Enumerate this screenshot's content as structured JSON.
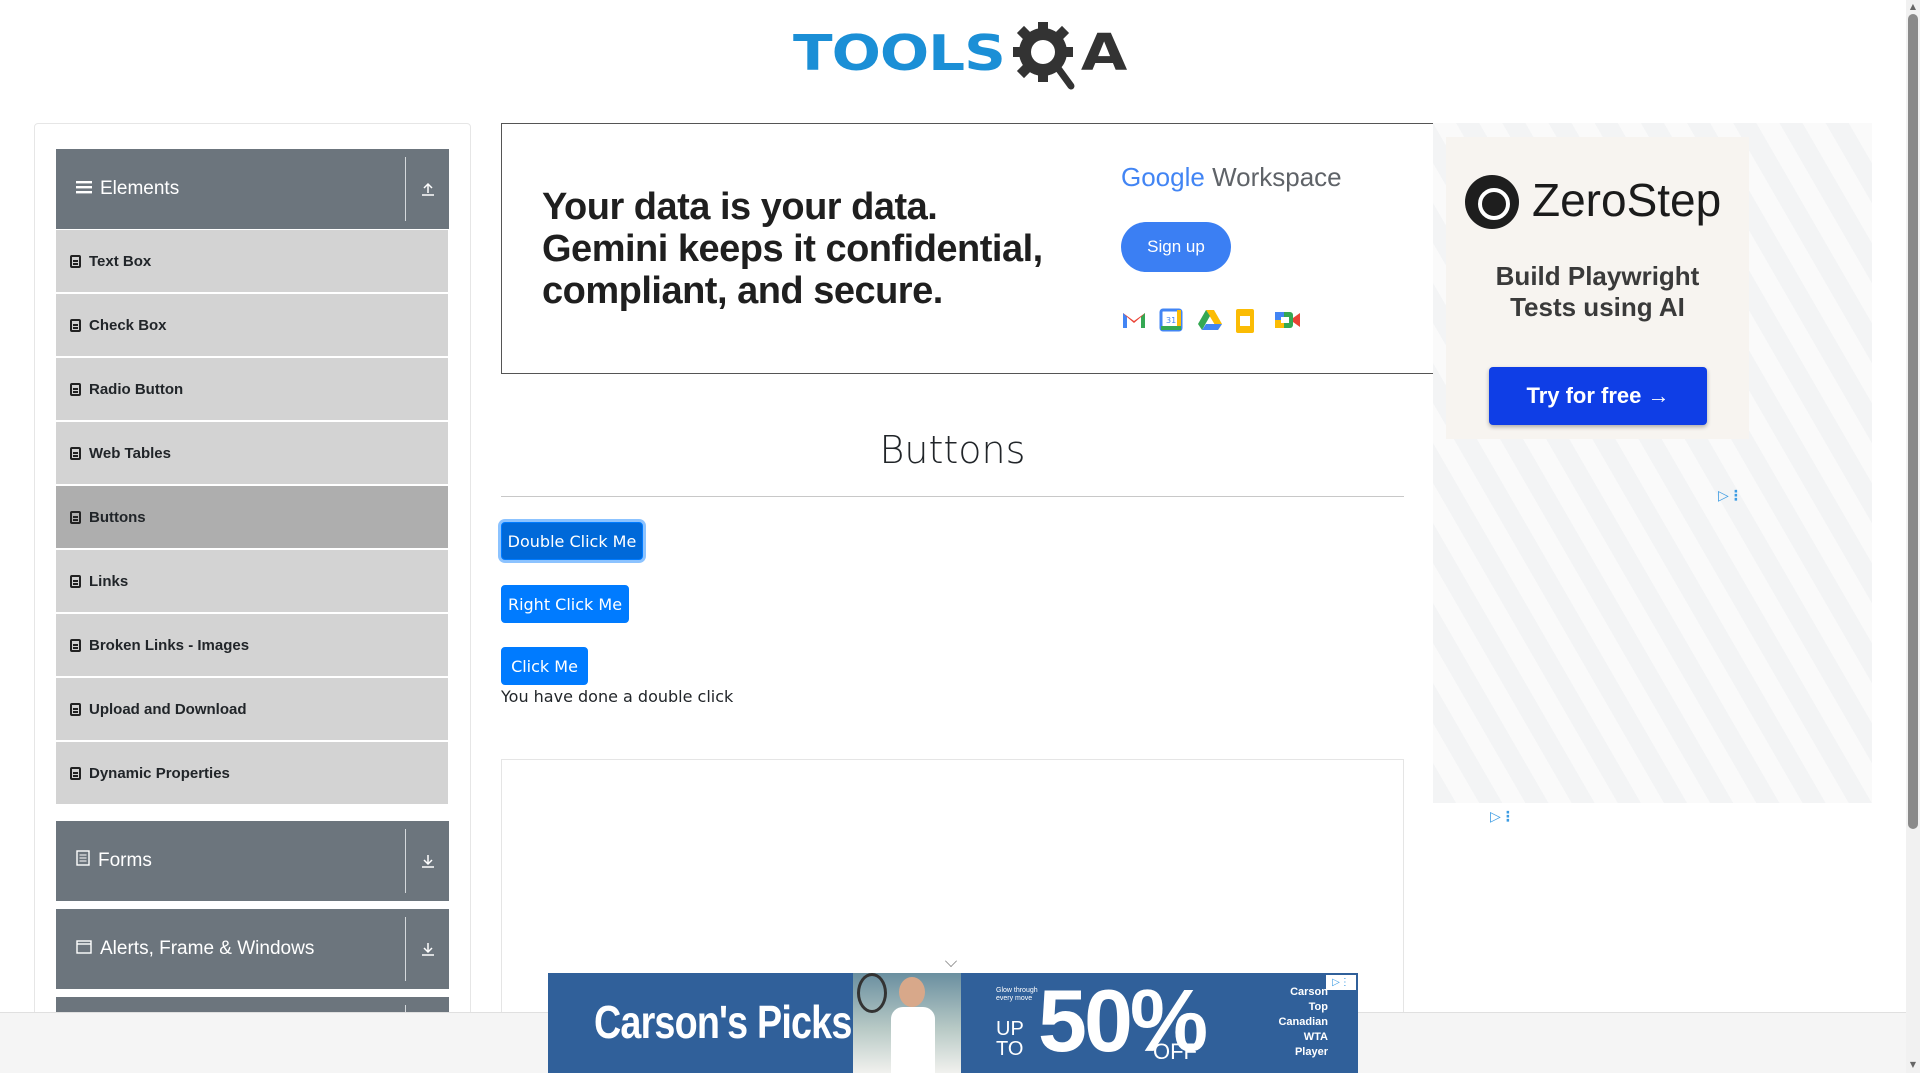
{
  "logo": {
    "text_main": "TOOLS",
    "text_end": "A"
  },
  "sidebar": {
    "elements_group": {
      "label": "Elements",
      "state_icon": "arrow-up-icon"
    },
    "items": [
      {
        "label": "Text Box"
      },
      {
        "label": "Check Box"
      },
      {
        "label": "Radio Button"
      },
      {
        "label": "Web Tables"
      },
      {
        "label": "Buttons"
      },
      {
        "label": "Links"
      },
      {
        "label": "Broken Links - Images"
      },
      {
        "label": "Upload and Download"
      },
      {
        "label": "Dynamic Properties"
      }
    ],
    "active_item": "Buttons",
    "forms_group": {
      "label": "Forms",
      "state_icon": "arrow-down-icon"
    },
    "alerts_group": {
      "label": "Alerts, Frame & Windows",
      "state_icon": "arrow-down-icon"
    }
  },
  "top_ad": {
    "headline_line1": "Your data is your data.",
    "headline_line2": "Gemini keeps it confidential,",
    "headline_line3": "compliant, and secure.",
    "brand_google": "Google",
    "brand_workspace": "Workspace",
    "signup_label": "Sign up",
    "app_icons": [
      "gmail-icon",
      "calendar-icon",
      "drive-icon",
      "docs-icon",
      "meet-icon"
    ]
  },
  "right_ad": {
    "brand": "ZeroStep",
    "subtitle_line1": "Build Playwright",
    "subtitle_line2": "Tests using AI",
    "cta": "Try for free →"
  },
  "main": {
    "title": "Buttons",
    "double_click_label": "Double Click Me",
    "right_click_label": "Right Click Me",
    "click_label": "Click Me",
    "message": "You have done a double click"
  },
  "bottom_ad": {
    "brand": "Carson's Picks",
    "glow_line1": "Glow through",
    "glow_line2": "every move",
    "up": "UP",
    "to": "TO",
    "percent": "50%",
    "off": "OFF",
    "player_lines": [
      "Carson",
      "Top",
      "Canadian",
      "WTA",
      "Player"
    ]
  },
  "colors": {
    "primary_button": "#007bff",
    "sidebar_header": "#6c757d",
    "sidebar_item": "#d3d3d3",
    "sidebar_item_active": "#aeaeae",
    "logo_blue": "#1b8fd6",
    "ad_blue": "#30609a"
  }
}
